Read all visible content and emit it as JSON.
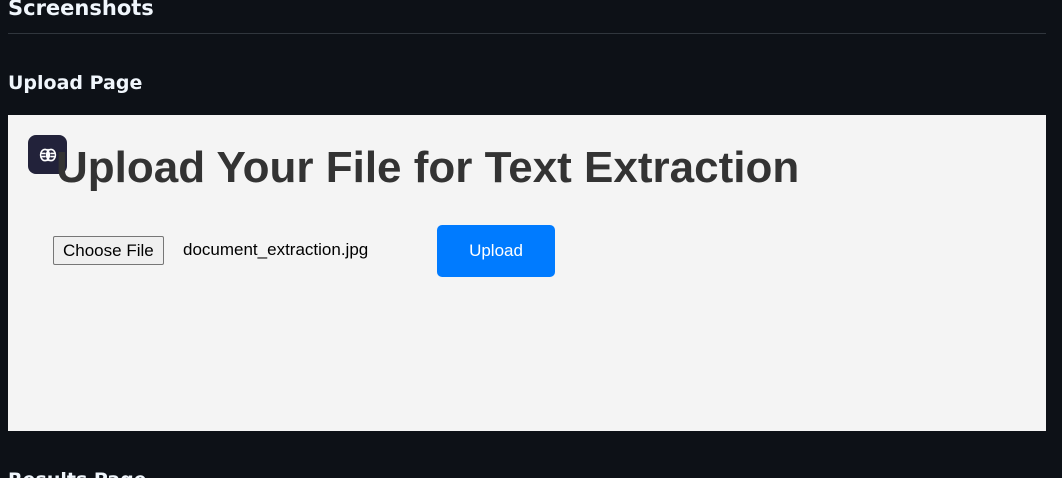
{
  "section": {
    "heading": "Screenshots"
  },
  "upload_section": {
    "heading": "Upload Page",
    "screenshot": {
      "badge_icon": "brain-icon",
      "title": "Upload Your File for Text Extraction",
      "choose_file_label": "Choose File",
      "selected_file": "document_extraction.jpg",
      "upload_label": "Upload",
      "accent_color": "#007bff"
    }
  },
  "result_section": {
    "heading": "Results Page"
  }
}
